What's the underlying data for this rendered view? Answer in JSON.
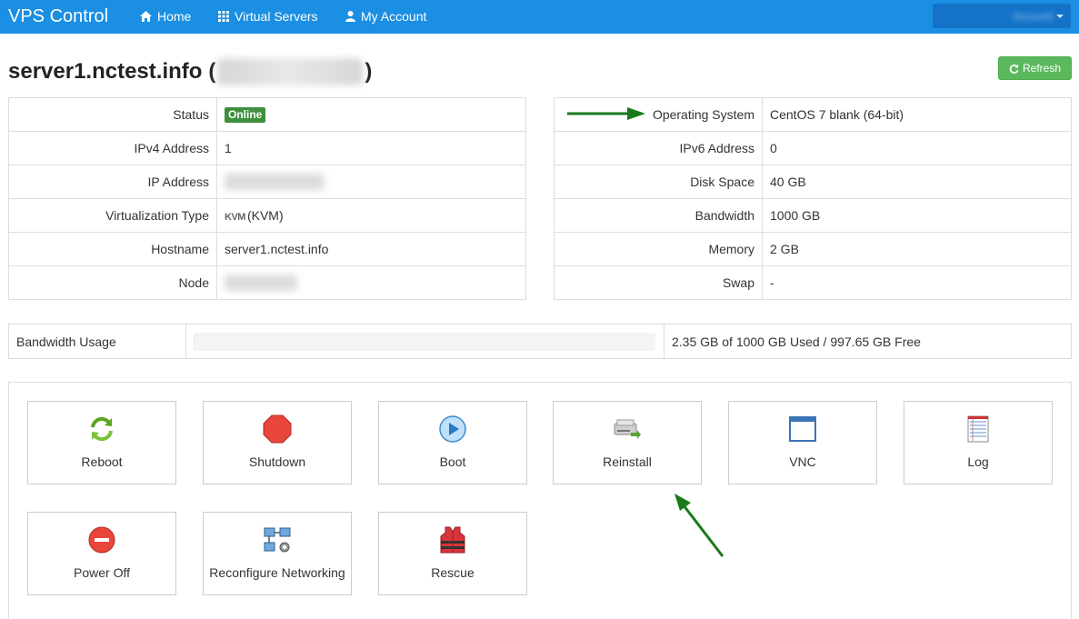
{
  "app": {
    "brand": "VPS Control",
    "nav": [
      {
        "label": "Home",
        "icon": "home-icon"
      },
      {
        "label": "Virtual Servers",
        "icon": "grid-icon"
      },
      {
        "label": "My Account",
        "icon": "user-icon"
      }
    ],
    "user_menu_label": "Account"
  },
  "server": {
    "hostname_title": "server1.nctest.info",
    "title_open": "(",
    "title_close": ")",
    "refresh_label": "Refresh"
  },
  "details_left": [
    {
      "label": "Status",
      "value": "Online"
    },
    {
      "label": "IPv4 Address",
      "value": "1"
    },
    {
      "label": "IP Address",
      "value": ""
    },
    {
      "label": "Virtualization Type",
      "value": "(KVM)",
      "logo": "KVM"
    },
    {
      "label": "Hostname",
      "value": "server1.nctest.info"
    },
    {
      "label": "Node",
      "value": ""
    }
  ],
  "details_right": [
    {
      "label": "Operating System",
      "value": "CentOS 7 blank (64-bit)"
    },
    {
      "label": "IPv6 Address",
      "value": "0"
    },
    {
      "label": "Disk Space",
      "value": "40 GB"
    },
    {
      "label": "Bandwidth",
      "value": "1000 GB"
    },
    {
      "label": "Memory",
      "value": "2 GB"
    },
    {
      "label": "Swap",
      "value": "-"
    }
  ],
  "bandwidth": {
    "label": "Bandwidth Usage",
    "used_fraction": 0.00235,
    "summary": "2.35 GB of 1000 GB Used / 997.65 GB Free"
  },
  "actions": [
    {
      "label": "Reboot",
      "icon": "reboot-icon"
    },
    {
      "label": "Shutdown",
      "icon": "shutdown-icon"
    },
    {
      "label": "Boot",
      "icon": "boot-icon"
    },
    {
      "label": "Reinstall",
      "icon": "reinstall-icon"
    },
    {
      "label": "VNC",
      "icon": "vnc-icon"
    },
    {
      "label": "Log",
      "icon": "log-icon"
    },
    {
      "label": "Power Off",
      "icon": "power-off-icon"
    },
    {
      "label": "Reconfigure Networking",
      "icon": "network-icon"
    },
    {
      "label": "Rescue",
      "icon": "rescue-icon"
    }
  ],
  "colors": {
    "navbar": "#1a8fe3",
    "online_badge": "#3e8f3e",
    "refresh_button": "#5cb85c",
    "annotation_arrow": "#1a7a1a"
  }
}
